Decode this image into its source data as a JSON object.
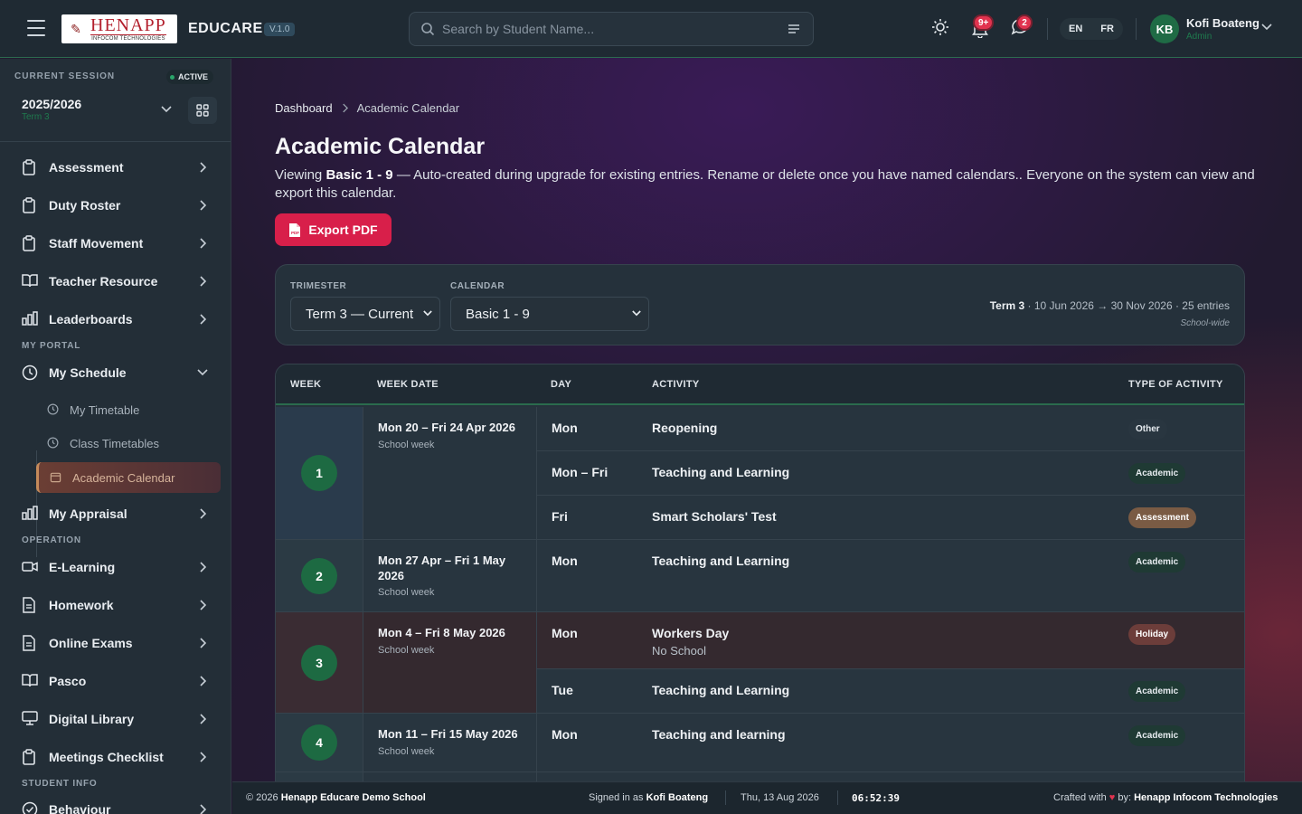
{
  "app": {
    "brand": "EDUCARE",
    "version": "V.1.0",
    "logo_text": "HENAPP",
    "logo_sub": "INFOCOM TECHNOLOGIES"
  },
  "header": {
    "search_placeholder": "Search by Student Name...",
    "notifications_badge": "9+",
    "messages_badge": "2",
    "lang_en": "EN",
    "lang_fr": "FR",
    "user_initials": "KB",
    "user_name": "Kofi Boateng",
    "user_role": "Admin"
  },
  "session": {
    "label": "CURRENT SESSION",
    "status": "ACTIVE",
    "year": "2025/2026",
    "term": "Term 3"
  },
  "sidebar": {
    "items_top": [
      {
        "label": "Assessment",
        "icon": "clipboard-icon"
      },
      {
        "label": "Duty Roster",
        "icon": "clipboard-icon"
      },
      {
        "label": "Staff Movement",
        "icon": "clipboard-icon"
      },
      {
        "label": "Teacher Resource",
        "icon": "book-open-icon"
      },
      {
        "label": "Leaderboards",
        "icon": "bar-chart-icon"
      }
    ],
    "section_portal": "MY PORTAL",
    "my_schedule": "My Schedule",
    "schedule_sub": [
      {
        "label": "My Timetable"
      },
      {
        "label": "Class Timetables"
      },
      {
        "label": "Academic Calendar"
      }
    ],
    "my_appraisal": "My Appraisal",
    "section_operation": "OPERATION",
    "items_operation": [
      {
        "label": "E-Learning",
        "icon": "video-icon"
      },
      {
        "label": "Homework",
        "icon": "document-icon"
      },
      {
        "label": "Online Exams",
        "icon": "document-icon"
      },
      {
        "label": "Pasco",
        "icon": "book-open-icon"
      },
      {
        "label": "Digital Library",
        "icon": "monitor-icon"
      },
      {
        "label": "Meetings Checklist",
        "icon": "clipboard-icon"
      }
    ],
    "section_student": "STUDENT INFO",
    "behaviour": "Behaviour"
  },
  "breadcrumb": {
    "home": "Dashboard",
    "current": "Academic Calendar"
  },
  "page": {
    "title": "Academic Calendar",
    "desc_prefix": "Viewing ",
    "desc_calendar": "Basic 1 - 9",
    "desc_rest": " — Auto-created during upgrade for existing entries. Rename or delete once you have named calendars.. Everyone on the system can view and export this calendar.",
    "export_label": "Export PDF"
  },
  "filters": {
    "trimester_label": "TRIMESTER",
    "trimester_value": "Term 3 — Current",
    "calendar_label": "CALENDAR",
    "calendar_value": "Basic 1 - 9",
    "meta_term": "Term 3",
    "meta_rest": " · 10 Jun 2026 → 30 Nov 2026 · 25 entries",
    "scope": "School-wide"
  },
  "table": {
    "headers": {
      "week": "WEEK",
      "week_date": "WEEK DATE",
      "day": "DAY",
      "activity": "ACTIVITY",
      "type": "TYPE OF ACTIVITY"
    },
    "weeks": [
      {
        "num": "1",
        "date": "Mon 20 – Fri 24 Apr 2026",
        "kind": "School week"
      },
      {
        "num": "2",
        "date": "Mon 27 Apr – Fri 1 May 2026",
        "kind": "School week"
      },
      {
        "num": "3",
        "date": "Mon 4 – Fri 8 May 2026",
        "kind": "School week"
      },
      {
        "num": "4",
        "date": "Mon 11 – Fri 15 May 2026",
        "kind": "School week"
      }
    ],
    "rows": [
      {
        "day": "Mon",
        "activity": "Reopening",
        "type": "Other"
      },
      {
        "day": "Mon – Fri",
        "activity": "Teaching and Learning",
        "type": "Academic"
      },
      {
        "day": "Fri",
        "activity": "Smart Scholars' Test",
        "type": "Assessment"
      },
      {
        "day": "Mon",
        "activity": "Teaching and Learning",
        "type": "Academic"
      },
      {
        "day": "Mon",
        "activity": "Workers Day",
        "note": "No School",
        "type": "Holiday"
      },
      {
        "day": "Tue",
        "activity": "Teaching and Learning",
        "type": "Academic"
      },
      {
        "day": "Mon",
        "activity": "Teaching and learning",
        "type": "Academic"
      }
    ]
  },
  "footer": {
    "copyright": "© 2026 ",
    "school": "Henapp Educare Demo School",
    "signed_prefix": "Signed in as ",
    "signed_user": "Kofi Boateng",
    "date": "Thu, 13 Aug 2026",
    "time": "06:52:39",
    "crafted": "Crafted with ",
    "by": " by: ",
    "company": "Henapp Infocom Technologies"
  },
  "colors": {
    "accent": "#d81f4a",
    "green": "#1d6a42",
    "bg": "#221a30"
  }
}
